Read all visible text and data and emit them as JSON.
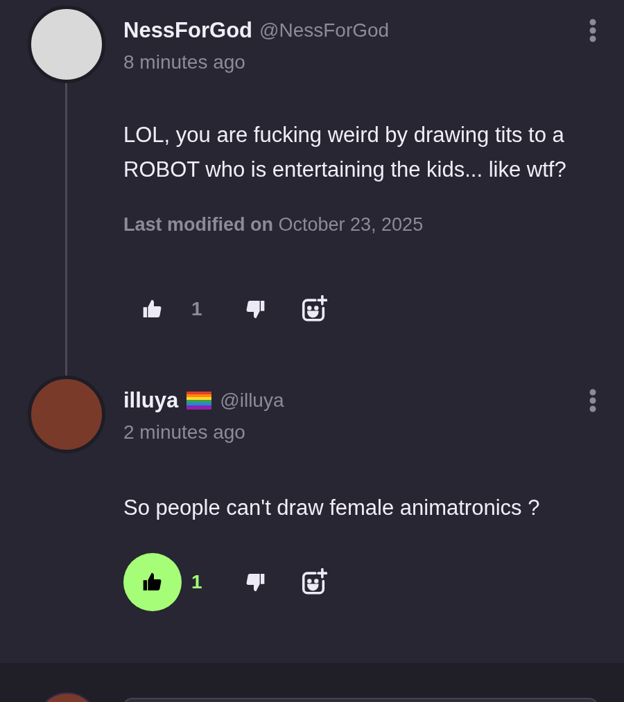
{
  "comments": [
    {
      "name": "NessForGod",
      "flag": false,
      "handle": "@NessForGod",
      "time": "8 minutes ago",
      "body": "LOL, you are fucking weird by drawing tits to a ROBOT who is entertaining the kids... like wtf?",
      "modified": "**Last modified on** October 23, 2025",
      "likes": "1",
      "liked": false,
      "thread_line": true
    },
    {
      "name": "illuya",
      "flag": true,
      "handle": "@illuya",
      "time": "2 minutes ago",
      "body": "So people can't draw female animatronics ?",
      "likes": "1",
      "liked": true,
      "thread_line": false
    }
  ]
}
